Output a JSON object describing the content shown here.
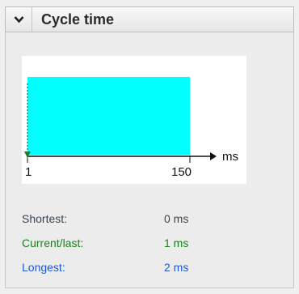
{
  "panel": {
    "title": "Cycle time",
    "collapse_icon": "chevron-down-icon"
  },
  "chart_data": {
    "type": "bar",
    "xlabel": "ms",
    "ylabel": "",
    "title": "",
    "xlim": [
      1,
      150
    ],
    "tick_labels": [
      "1",
      "150"
    ],
    "bar_color": "#00ffff",
    "current_marker": {
      "value": 1,
      "color": "#1b7f1b"
    }
  },
  "stats": {
    "shortest": {
      "label": "Shortest:",
      "value": "0 ms",
      "color": "#3c4650"
    },
    "current": {
      "label": "Current/last:",
      "value": "1 ms",
      "color": "#1b7f1b"
    },
    "longest": {
      "label": "Longest:",
      "value": "2 ms",
      "color": "#1f58d6"
    }
  }
}
